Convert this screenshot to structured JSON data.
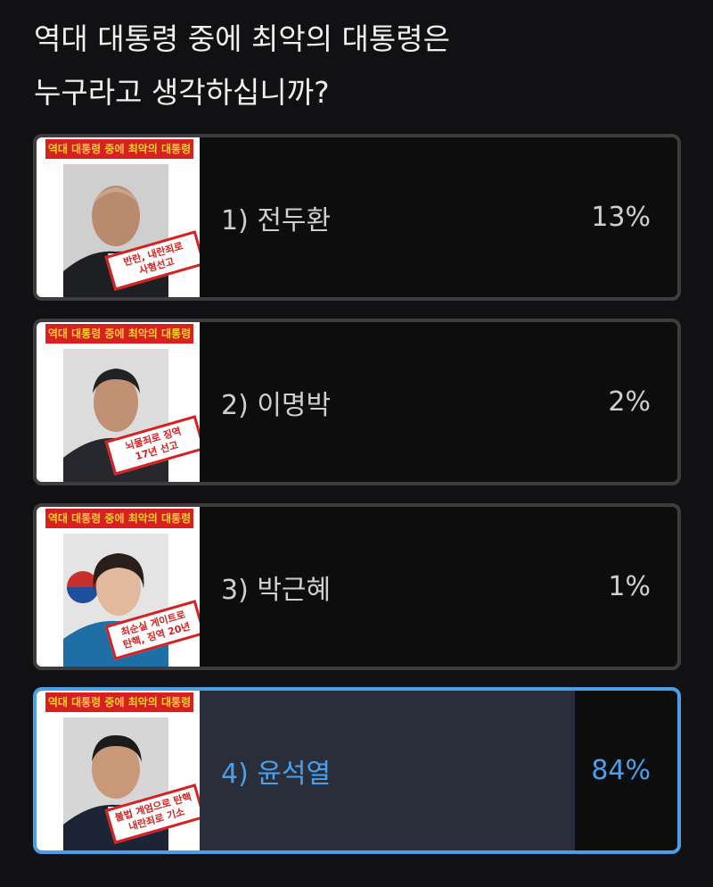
{
  "question": {
    "line1": "역대 대통령 중에 최악의 대통령은",
    "line2": "누구라고 생각하십니까?"
  },
  "options": [
    {
      "label": "1) 전두환",
      "percent_text": "13%",
      "percent": 13,
      "banner": "역대 대통령 중에 최악의 대통령",
      "stamp": "반란, 내란죄로\n사형선고",
      "selected": false
    },
    {
      "label": "2) 이명박",
      "percent_text": "2%",
      "percent": 2,
      "banner": "역대 대통령 중에 최악의 대통령",
      "stamp": "뇌물죄로 징역\n17년 선고",
      "selected": false
    },
    {
      "label": "3) 박근혜",
      "percent_text": "1%",
      "percent": 1,
      "banner": "역대 대통령 중에 최악의 대통령",
      "stamp": "최순실 게이트로\n탄핵, 징역 20년",
      "selected": false
    },
    {
      "label": "4) 윤석열",
      "percent_text": "84%",
      "percent": 84,
      "banner": "역대 대통령 중에 최악의 대통령",
      "stamp": "불법 계엄으로 탄핵\n내란죄로 기소",
      "selected": true
    }
  ],
  "colors": {
    "background": "#111113",
    "border": "#3d3d40",
    "fill": "#3a3a3c",
    "selected_accent": "#4a9fe6",
    "selected_fill": "#2a2e3a",
    "banner_red": "#d72020",
    "banner_text": "#ffd02a"
  }
}
